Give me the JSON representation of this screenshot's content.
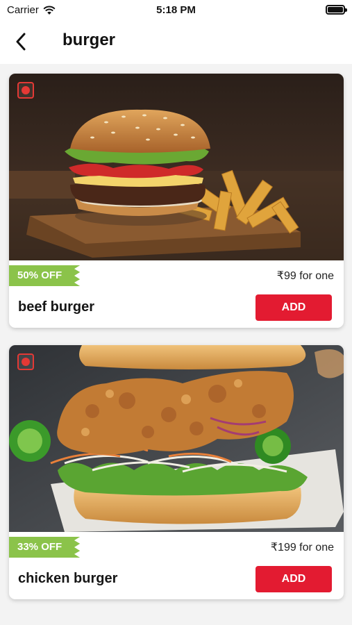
{
  "status_bar": {
    "carrier": "Carrier",
    "time": "5:18 PM"
  },
  "header": {
    "title": "burger"
  },
  "items": [
    {
      "name": "beef burger",
      "discount": "50% OFF",
      "price": "₹99 for one",
      "add_label": "ADD"
    },
    {
      "name": "chicken burger",
      "discount": "33% OFF",
      "price": "₹199 for one",
      "add_label": "ADD"
    }
  ],
  "colors": {
    "accent": "#e31b31",
    "discount_badge": "#8bc34a",
    "food_type_mark": "#e53935"
  }
}
